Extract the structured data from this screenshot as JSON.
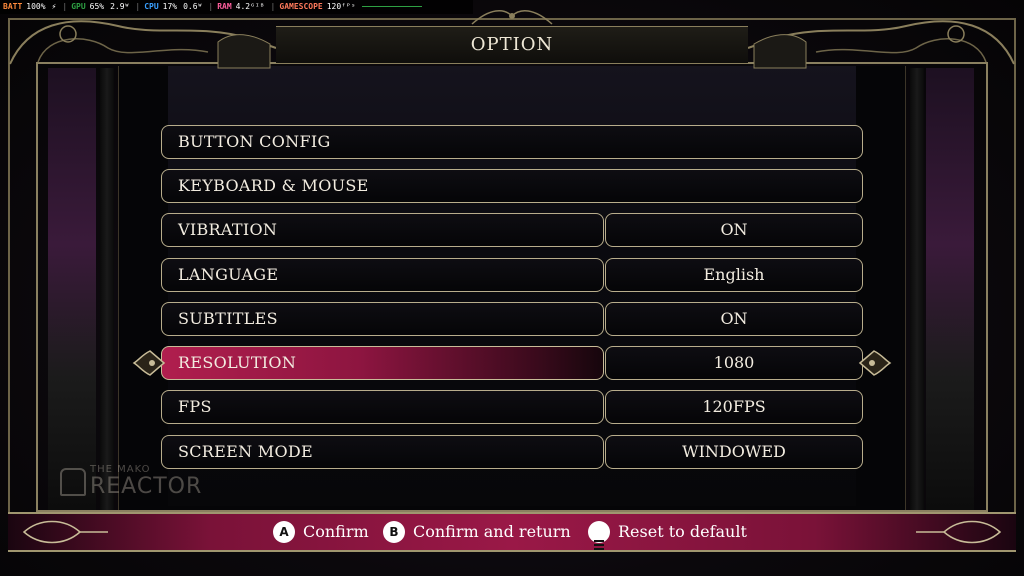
{
  "overlay": {
    "batt_label": "BATT",
    "batt_value": "100%",
    "gpu_label": "GPU",
    "gpu_value": "65%",
    "gpu_power": "2.9ᵂ",
    "cpu_label": "CPU",
    "cpu_value": "17%",
    "cpu_power": "0.6ᵂ",
    "ram_label": "RAM",
    "ram_value": "4.2ᴳᴵᴮ",
    "gs_label": "GAMESCOPE",
    "gs_value": "120ᶠᴾˢ",
    "colors": {
      "batt": "#ff8a3c",
      "gpu": "#2ea043",
      "cpu": "#3aa0ff",
      "ram": "#ff5f9e",
      "gs": "#ff7a5c"
    }
  },
  "header": {
    "title": "OPTION"
  },
  "options": [
    {
      "label": "BUTTON CONFIG",
      "value": null
    },
    {
      "label": "KEYBOARD & MOUSE",
      "value": null
    },
    {
      "label": "VIBRATION",
      "value": "ON"
    },
    {
      "label": "LANGUAGE",
      "value": "English"
    },
    {
      "label": "SUBTITLES",
      "value": "ON"
    },
    {
      "label": "RESOLUTION",
      "value": "1080",
      "selected": true
    },
    {
      "label": "FPS",
      "value": "120FPS"
    },
    {
      "label": "SCREEN MODE",
      "value": "WINDOWED"
    }
  ],
  "footer": {
    "confirm_button": "A",
    "confirm_label": "Confirm",
    "return_button": "B",
    "return_label": "Confirm and return",
    "reset_icon": "menu-icon",
    "reset_label": "Reset to default"
  },
  "watermark": {
    "line1": "THE MAKO",
    "line2": "REACTOR"
  },
  "colors": {
    "accent": "#9a1847",
    "frame": "#b8ad8c",
    "selected": "#b01e4e"
  }
}
